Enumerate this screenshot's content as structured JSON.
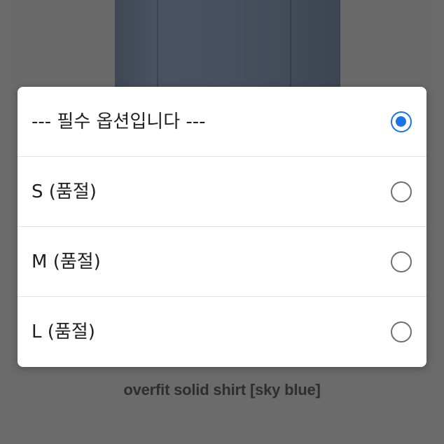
{
  "dialog": {
    "options": [
      {
        "label": "--- 필수 옵션입니다 ---",
        "selected": true
      },
      {
        "label": "S (품절)",
        "selected": false
      },
      {
        "label": "M (품절)",
        "selected": false
      },
      {
        "label": "L (품절)",
        "selected": false
      }
    ]
  },
  "product": {
    "name": "overfit solid shirt [sky blue]"
  },
  "colors": {
    "accent": "#1a73e8",
    "backdrop": "#6b6b6b",
    "dialog_background": "#ffffff"
  }
}
